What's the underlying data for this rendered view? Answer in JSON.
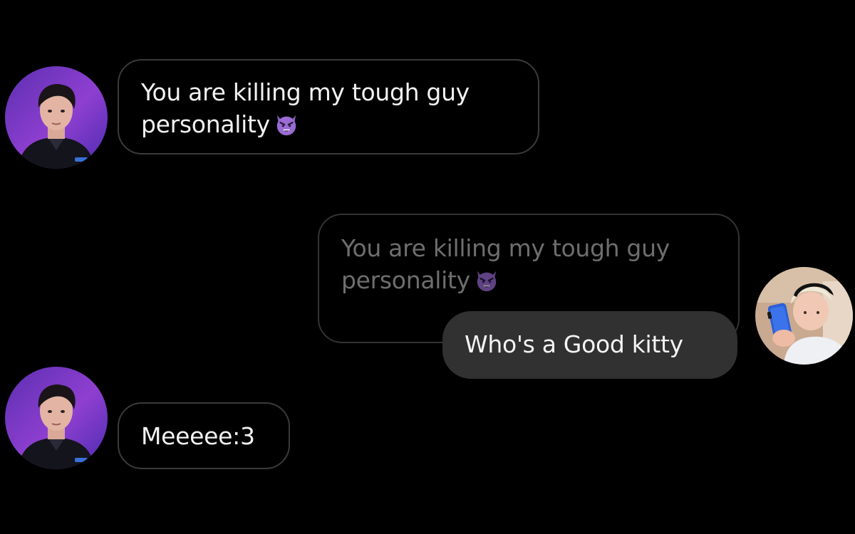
{
  "conversation": {
    "messages": [
      {
        "sender": "left",
        "line1": "You are killing my tough guy",
        "line2": "personality",
        "emoji": "smiling-devil-icon"
      },
      {
        "sender": "right",
        "quoted_line1": "You are killing my tough guy",
        "quoted_line2": "personality",
        "quoted_emoji": "smiling-devil-icon",
        "text": "Who's a Good kitty"
      },
      {
        "sender": "left",
        "text": "Meeeee:3"
      }
    ]
  },
  "colors": {
    "background": "#000000",
    "bubble_border": "#3a3a3a",
    "filled_bubble": "#313131",
    "text": "#f2f2f2",
    "quoted_text": "#6e6e6e",
    "emoji_purple": "#8d5fc9"
  }
}
